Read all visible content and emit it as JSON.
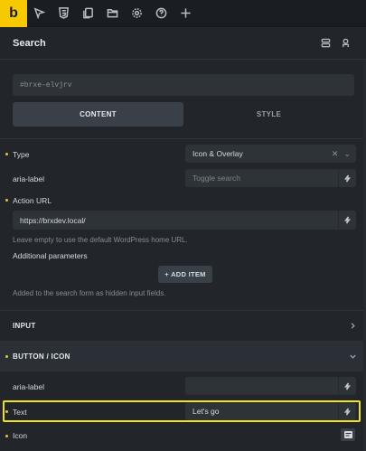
{
  "topbar": {
    "logo": "b",
    "icons": [
      "cursor-icon",
      "css3-icon",
      "copy-icon",
      "folder-icon",
      "gear-icon",
      "help-icon",
      "plus-icon"
    ]
  },
  "header": {
    "title": "Search"
  },
  "element_id": "#brxe-elvjrv",
  "tabs": {
    "content": "CONTENT",
    "style": "STYLE"
  },
  "fields": {
    "type": {
      "label": "Type",
      "value": "Icon & Overlay"
    },
    "aria_label": {
      "label": "aria-label",
      "placeholder": "Toggle search"
    },
    "action_url": {
      "label": "Action URL",
      "value": "https://brxdev.local/",
      "help": "Leave empty to use the default WordPress home URL."
    },
    "additional_params": {
      "label": "Additional parameters",
      "button": "+ ADD ITEM",
      "help": "Added to the search form as hidden input fields."
    }
  },
  "sections": {
    "input": "INPUT",
    "button_icon": "BUTTON / ICON"
  },
  "button_icon": {
    "aria_label": {
      "label": "aria-label",
      "placeholder": ""
    },
    "text": {
      "label": "Text",
      "value": "Let's go"
    },
    "icon": {
      "label": "Icon"
    }
  },
  "colors": {
    "accent": "#f7c900",
    "highlight": "#f0e21f",
    "dot": "#d8c84a"
  }
}
